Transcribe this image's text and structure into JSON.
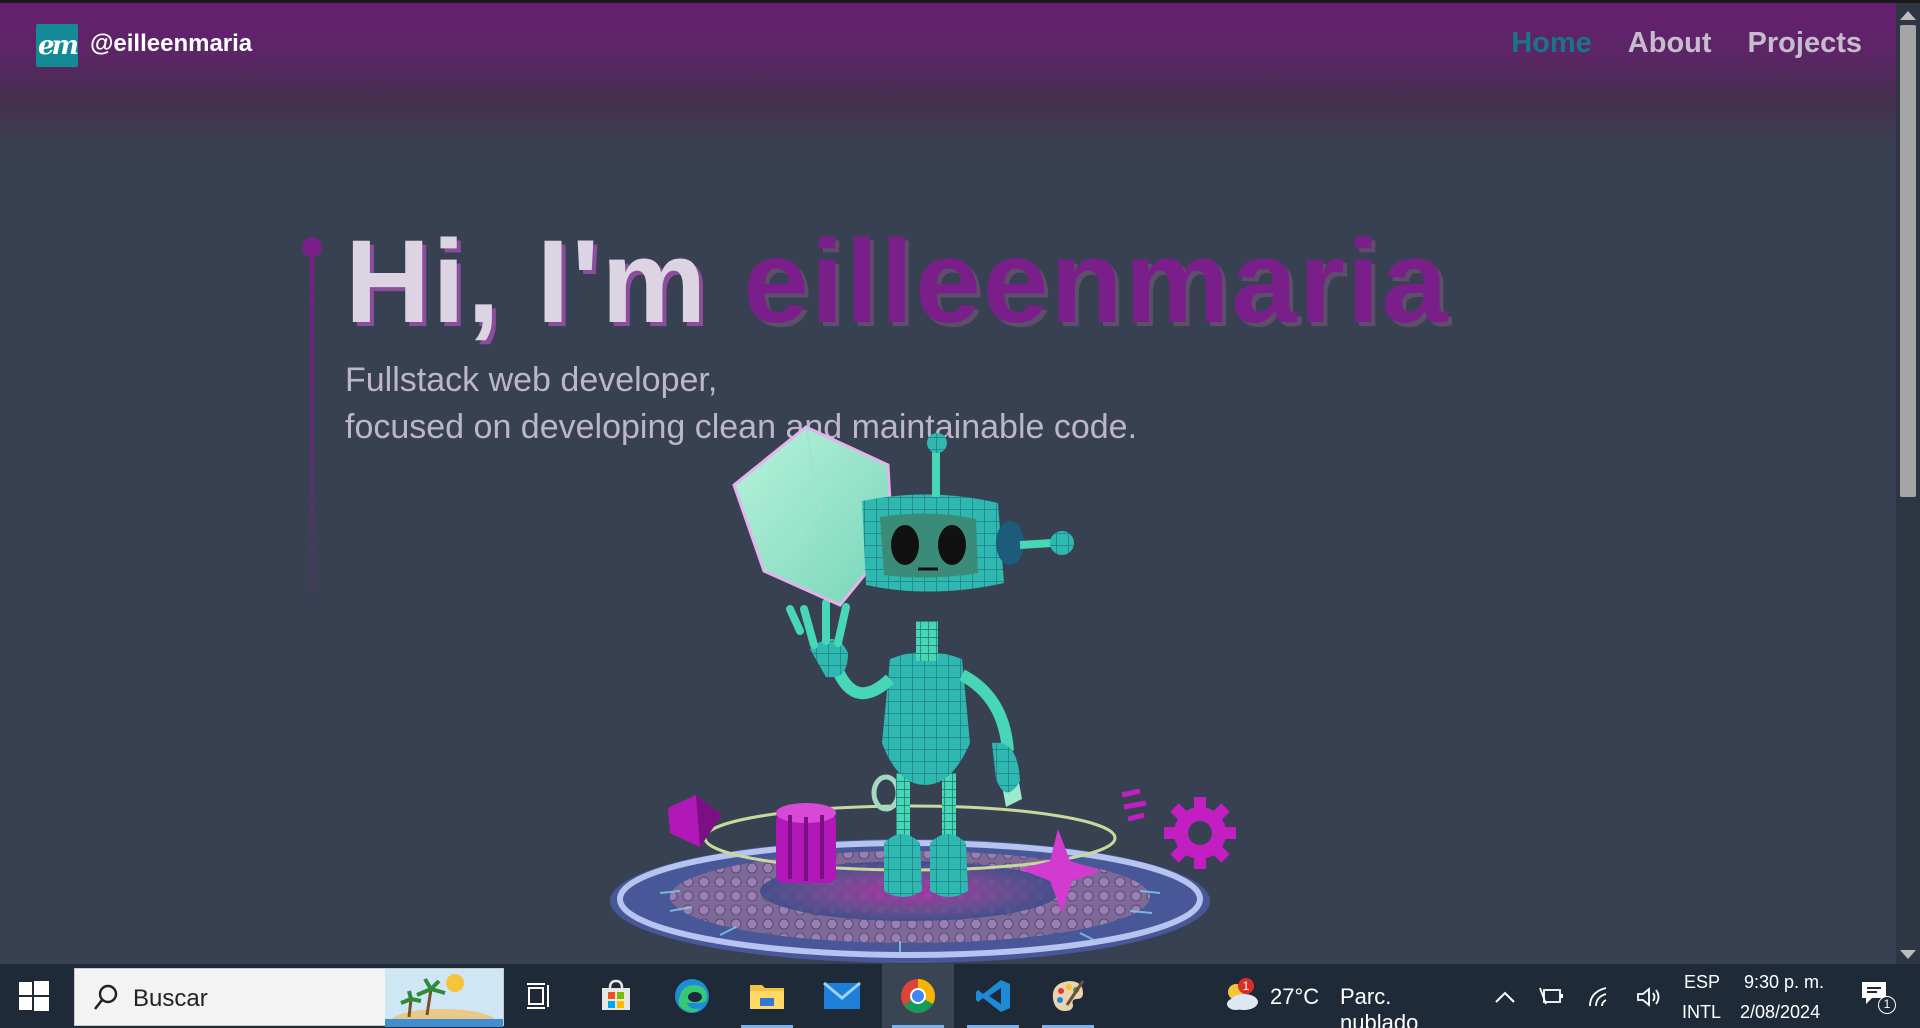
{
  "header": {
    "logo_text": "em",
    "brand": "@eilleenmaria",
    "nav": [
      {
        "label": "Home",
        "active": true
      },
      {
        "label": "About",
        "active": false
      },
      {
        "label": "Projects",
        "active": false
      }
    ]
  },
  "hero": {
    "greeting": "Hi, I'm",
    "name": "eilleenmaria",
    "subtitle_line1": "Fullstack web developer,",
    "subtitle_line2": "focused on developing clean and maintainable code."
  },
  "colors": {
    "accent_purple": "#7a1f8a",
    "teal": "#177585",
    "background": "#384152"
  },
  "taskbar": {
    "search_placeholder": "Buscar",
    "apps": [
      "task-view-icon",
      "store-icon",
      "edge-icon",
      "file-explorer-icon",
      "mail-icon",
      "chrome-icon",
      "vscode-icon",
      "paint-icon"
    ],
    "weather_badge": "1",
    "weather_temp": "27°C",
    "weather_desc": "Parc. nublado",
    "lang_top": "ESP",
    "lang_bottom": "INTL",
    "time": "9:30 p. m.",
    "date": "2/08/2024",
    "notification_count": "1"
  }
}
